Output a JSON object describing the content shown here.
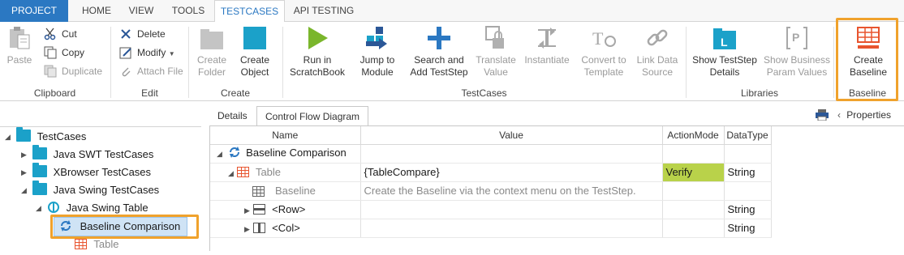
{
  "tabs": {
    "project": "PROJECT",
    "home": "HOME",
    "view": "VIEW",
    "tools": "TOOLS",
    "testcases": "TESTCASES",
    "api_testing": "API TESTING"
  },
  "ribbon": {
    "clipboard": {
      "label": "Clipboard",
      "paste": "Paste",
      "cut": "Cut",
      "copy": "Copy",
      "duplicate": "Duplicate"
    },
    "edit": {
      "label": "Edit",
      "delete": "Delete",
      "modify": "Modify",
      "attach_file": "Attach File"
    },
    "create": {
      "label": "Create",
      "create_folder": "Create\nFolder",
      "create_object": "Create\nObject"
    },
    "testcases": {
      "label": "TestCases",
      "run_in_scratchbook": "Run in\nScratchBook",
      "jump_to_module": "Jump to\nModule",
      "search_and_add": "Search and\nAdd TestStep",
      "translate_value": "Translate\nValue",
      "instantiate": "Instantiate",
      "convert_to_template": "Convert to\nTemplate",
      "link_data_source": "Link Data\nSource"
    },
    "libraries": {
      "label": "Libraries",
      "show_teststep_details": "Show TestStep\nDetails",
      "show_business_param": "Show Business\nParam Values"
    },
    "baseline": {
      "label": "Baseline",
      "create_baseline": "Create\nBaseline"
    }
  },
  "details": {
    "tab_details": "Details",
    "tab_control_flow": "Control Flow Diagram",
    "properties": "Properties"
  },
  "grid": {
    "headers": [
      "Name",
      "Value",
      "ActionMode",
      "DataType"
    ],
    "rows": [
      {
        "name": "Baseline Comparison",
        "value": "",
        "action": "",
        "type": ""
      },
      {
        "name": "Table",
        "value": "{TableCompare}",
        "action": "Verify",
        "type": "String"
      },
      {
        "name": "Baseline",
        "value": "Create the Baseline via the context menu on the TestStep.",
        "action": "",
        "type": ""
      },
      {
        "name": "<Row>",
        "value": "",
        "action": "",
        "type": "String"
      },
      {
        "name": "<Col>",
        "value": "",
        "action": "",
        "type": "String"
      }
    ]
  },
  "tree": {
    "root": "TestCases",
    "java_swt": "Java SWT TestCases",
    "xbrowser": "XBrowser TestCases",
    "java_swing": "Java Swing TestCases",
    "java_swing_table": "Java Swing Table",
    "baseline_comparison": "Baseline Comparison",
    "table": "Table"
  },
  "colors": {
    "accent": "#2b78c2",
    "folder": "#1ba1c9",
    "highlight": "#f0a22c",
    "verify": "#b9d24a",
    "baseline_icon": "#e8542e"
  }
}
